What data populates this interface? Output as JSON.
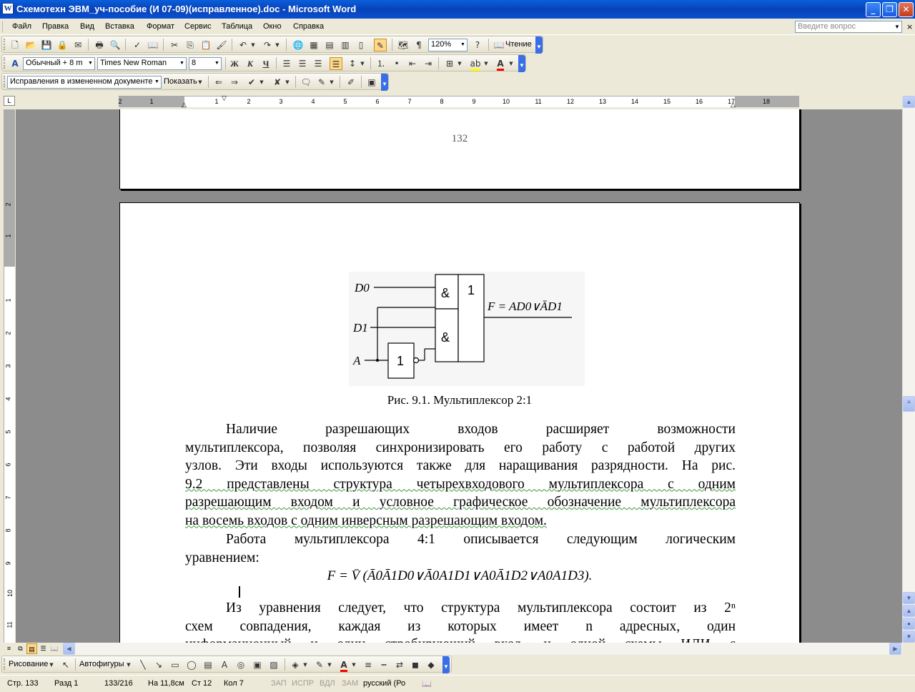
{
  "window": {
    "title": "Схемотехн ЭВМ_уч-пособие (И 07-09)(исправленное).doc - Microsoft Word",
    "app_icon": "W",
    "minimize_icon": "minimize-icon",
    "maximize_icon": "maximize-icon",
    "close_icon": "close-icon"
  },
  "menu": {
    "items": [
      "Файл",
      "Правка",
      "Вид",
      "Вставка",
      "Формат",
      "Сервис",
      "Таблица",
      "Окно",
      "Справка"
    ],
    "ask_placeholder": "Введите вопрос",
    "close_doc": "×"
  },
  "toolbar_standard": {
    "zoom": "120%",
    "reading_label": "Чтение"
  },
  "toolbar_formatting": {
    "style": "Обычный + 8 m",
    "font": "Times New Roman",
    "size": "8",
    "bold": "Ж",
    "italic": "К",
    "underline": "Ч",
    "highlight_color": "#FFFF00",
    "font_color": "#FF0000"
  },
  "toolbar_reviewing": {
    "display_mode": "Исправления в измененном документе",
    "show_label": "Показать"
  },
  "ruler": {
    "h_numbers": [
      "2",
      "1",
      "1",
      "2",
      "3",
      "4",
      "5",
      "6",
      "7",
      "8",
      "9",
      "10",
      "11",
      "12",
      "13",
      "14",
      "15",
      "16",
      "17",
      "18"
    ],
    "v_numbers": [
      "2",
      "1",
      "1",
      "2",
      "3",
      "4",
      "5",
      "6",
      "7",
      "8",
      "9",
      "10",
      "11"
    ],
    "box_label": "L"
  },
  "document": {
    "page_number": "132",
    "figure": {
      "labels": {
        "d0": "D0",
        "d1": "D1",
        "a": "A",
        "and_top": "&",
        "and_bottom": "&",
        "or_gate": "1",
        "inverter": "1",
        "output": "F = AD0∨ĀD1"
      }
    },
    "caption": "Рис. 9.1.   Мультиплексор 2:1",
    "paragraph1_lines": [
      "Наличие разрешающих входов расширяет возможности",
      "мультиплексора, позволяя синхронизировать его работу с работой других",
      "узлов. Эти входы используются также для наращивания разрядности. На рис.",
      "9.2 представлены структура четырехвходового мультиплексора  с одним",
      "разрешающим входом и  условное графическое обозначение мультиплексора",
      "на восемь входов с одним инверсным разрешающим входом."
    ],
    "paragraph2_lines": [
      "Работа мультиплексора 4:1 описывается следующим логическим",
      "уравнением:"
    ],
    "formula": "F = V̄ (Ā0Ā1D0∨Ā0A1D1∨A0Ā1D2∨A0A1D3).",
    "paragraph3_lines": [
      "Из уравнения следует, что структура мультиплексора состоит из 2ⁿ",
      "схем совпадения, каждая из которых имеет n адресных, один",
      "информационный и один стробирующий вход, и одной схемы ИЛИ с"
    ]
  },
  "drawing_toolbar": {
    "draw_label": "Рисование",
    "autoshapes_label": "Автофигуры"
  },
  "statusbar": {
    "page": "Стр. 133",
    "section": "Разд 1",
    "page_of": "133/216",
    "at": "На 11,8см",
    "line": "Ст 12",
    "col": "Кол 7",
    "rec": "ЗАП",
    "trk": "ИСПР",
    "ext": "ВДЛ",
    "ovr": "ЗАМ",
    "language": "русский (Ро"
  }
}
